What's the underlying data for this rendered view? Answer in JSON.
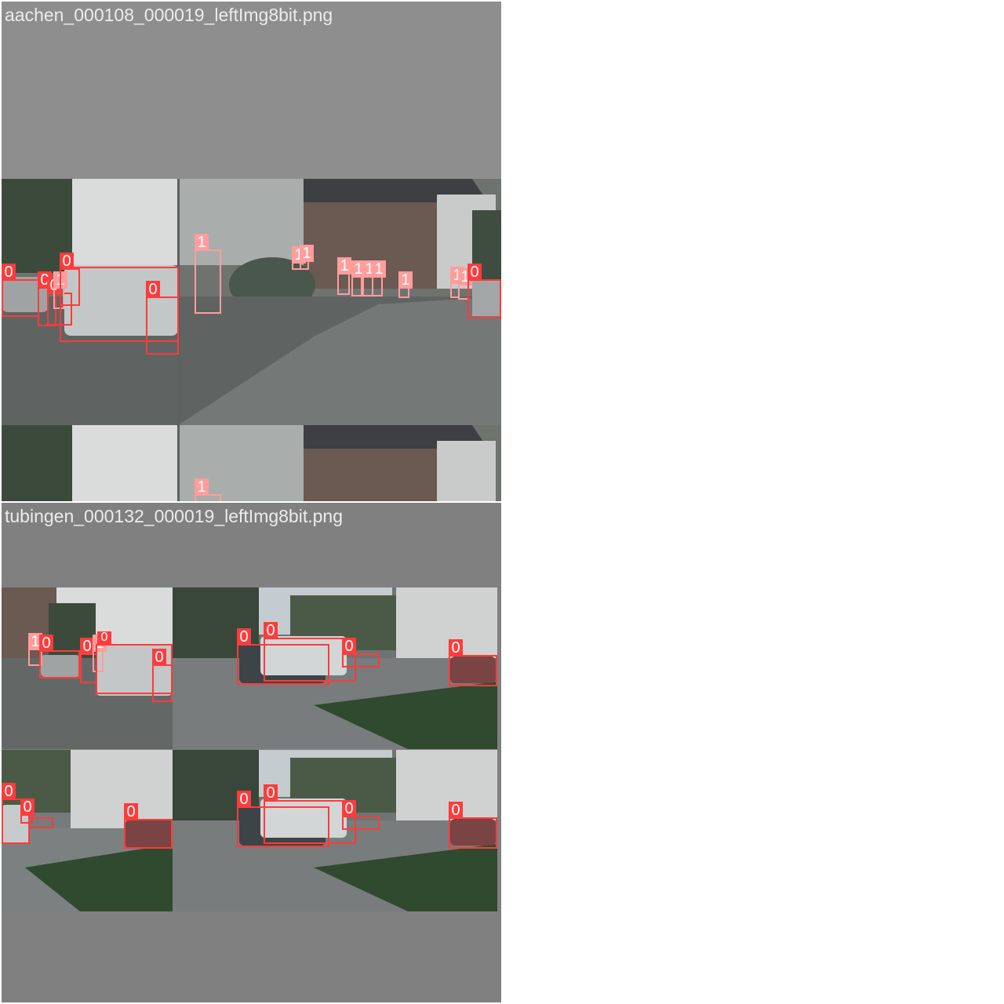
{
  "tiles": [
    {
      "filename": "aachen_000108_000019_leftImg8bit.png"
    },
    {
      "filename": "tubingen_000132_000019_leftImg8bit.png"
    }
  ],
  "class_labels": {
    "vehicle": "0",
    "person": "1"
  },
  "colors": {
    "vehicle_box": "#ff3b3b",
    "person_box": "#ff9d9d",
    "letterbox_top": "#8e8e8e",
    "letterbox_bottom": "#808080",
    "filename_text": "#ececec"
  }
}
